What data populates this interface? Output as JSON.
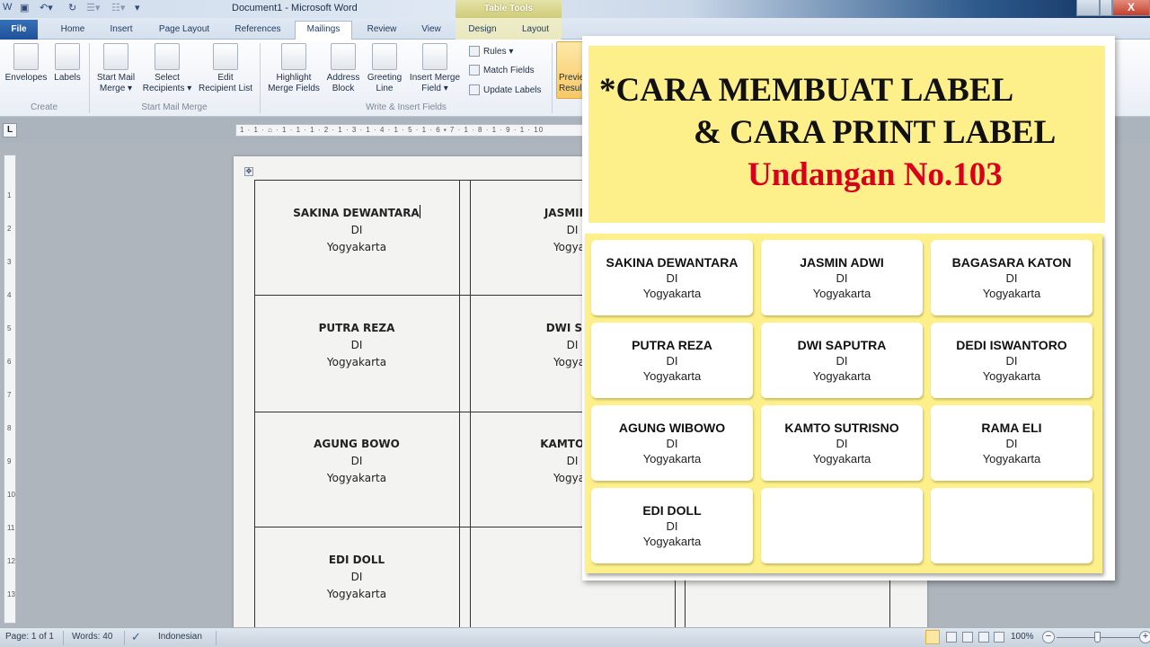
{
  "window": {
    "title": "Document1  -  Microsoft Word",
    "contextual_tab_group": "Table Tools",
    "close_label": "X"
  },
  "tabs": [
    {
      "label": "File"
    },
    {
      "label": "Home"
    },
    {
      "label": "Insert"
    },
    {
      "label": "Page Layout"
    },
    {
      "label": "References"
    },
    {
      "label": "Mailings",
      "active": true
    },
    {
      "label": "Review"
    },
    {
      "label": "View"
    },
    {
      "label": "Design"
    },
    {
      "label": "Layout"
    }
  ],
  "ribbon": {
    "groups": {
      "create": "Create",
      "start_mail_merge": "Start Mail Merge",
      "write_insert": "Write & Insert Fields"
    },
    "buttons": {
      "envelopes": "Envelopes",
      "labels": "Labels",
      "start_mail_merge_1": "Start Mail",
      "start_mail_merge_2": "Merge ▾",
      "select_recipients_1": "Select",
      "select_recipients_2": "Recipients ▾",
      "edit_list_1": "Edit",
      "edit_list_2": "Recipient List",
      "highlight_1": "Highlight",
      "highlight_2": "Merge Fields",
      "address_1": "Address",
      "address_2": "Block",
      "greeting_1": "Greeting",
      "greeting_2": "Line",
      "insert_field_1": "Insert Merge",
      "insert_field_2": "Field ▾",
      "rules": "Rules ▾",
      "match_fields": "Match Fields",
      "update_labels": "Update Labels",
      "preview_1": "Previe",
      "preview_2": "Resul"
    }
  },
  "ruler": {
    "horizontal": "1 · 1 · ⌂ · 1 · 1 · 1 · 2 · 1 · 3 · 1 · 4 · 1 · 5 · 1 · 6 ▪ 7 · 1 · 8 · 1 · 9 · 1 · 10",
    "vertical_marks": [
      "1",
      "2",
      "3",
      "4",
      "5",
      "6",
      "7",
      "8",
      "9",
      "10",
      "11",
      "12",
      "13"
    ],
    "tab_selector": "L"
  },
  "document": {
    "cells": [
      {
        "name": "SAKINA DEWANTARA",
        "line2": "DI",
        "line3": "Yogyakarta"
      },
      {
        "name": "JASMIN A",
        "line2": "DI",
        "line3": "Yogyak"
      },
      {
        "name": "PUTRA REZA",
        "line2": "DI",
        "line3": "Yogyakarta"
      },
      {
        "name": "DWI SAP",
        "line2": "DI",
        "line3": "Yogyak"
      },
      {
        "name": "AGUNG BOWO",
        "line2": "DI",
        "line3": "Yogyakarta"
      },
      {
        "name": "KAMTO SU",
        "line2": "DI",
        "line3": "Yogyak"
      },
      {
        "name": "EDI DOLL",
        "line2": "DI",
        "line3": "Yogyakarta"
      }
    ]
  },
  "overlay": {
    "title_line1": "*CARA MEMBUAT LABEL",
    "title_line2": "& CARA PRINT LABEL",
    "title_line3": "Undangan No.103",
    "title_color": "#111111",
    "accent_color": "#d9001b",
    "background_color": "#fdf08a",
    "labels": [
      {
        "name": "SAKINA DEWANTARA",
        "line2": "DI",
        "line3": "Yogyakarta"
      },
      {
        "name": "JASMIN ADWI",
        "line2": "DI",
        "line3": "Yogyakarta"
      },
      {
        "name": "BAGASARA KATON",
        "line2": "DI",
        "line3": "Yogyakarta"
      },
      {
        "name": "PUTRA REZA",
        "line2": "DI",
        "line3": "Yogyakarta"
      },
      {
        "name": "DWI SAPUTRA",
        "line2": "DI",
        "line3": "Yogyakarta"
      },
      {
        "name": "DEDI ISWANTORO",
        "line2": "DI",
        "line3": "Yogyakarta"
      },
      {
        "name": "AGUNG WIBOWO",
        "line2": "DI",
        "line3": "Yogyakarta"
      },
      {
        "name": "KAMTO SUTRISNO",
        "line2": "DI",
        "line3": "Yogyakarta"
      },
      {
        "name": "RAMA ELI",
        "line2": "DI",
        "line3": "Yogyakarta"
      },
      {
        "name": "EDI DOLL",
        "line2": "DI",
        "line3": "Yogyakarta"
      },
      {
        "name": "",
        "line2": "",
        "line3": ""
      },
      {
        "name": "",
        "line2": "",
        "line3": ""
      }
    ]
  },
  "statusbar": {
    "page": "Page: 1 of 1",
    "words": "Words: 40",
    "language": "Indonesian",
    "zoom": "100%",
    "zoom_level_percent": 100
  }
}
